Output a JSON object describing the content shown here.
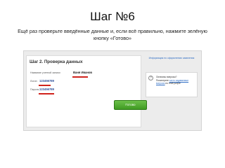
{
  "slide": {
    "title": "Шаг №6",
    "subtitle": "Ещё раз проверьте введённые данные и, если всё правильно, нажмите зелёную кнопку «Готово»"
  },
  "form": {
    "step_heading": "Шаг 2. Проверка данных",
    "rows": [
      {
        "label": "Название учетной записи",
        "value": "Ваня Иванов"
      },
      {
        "label": "Логин",
        "value": "123456789"
      },
      {
        "label": "Пароль",
        "value": "123456789"
      }
    ],
    "submit_label": "Готово"
  },
  "info_panel": {
    "header": "Информация по оформлению заявления",
    "help": {
      "question": "Остались вопросы?",
      "prefix": "Посмотрите",
      "link": "часто задаваемые вопросы",
      "suffix": "по этой услуге"
    }
  },
  "colors": {
    "underline": "#d0221c",
    "arrow": "#d0221c",
    "button": "#4caf2c",
    "link": "#2d6cc4"
  },
  "icons": [
    "help-question-icon",
    "pointer-arrow-icon"
  ]
}
